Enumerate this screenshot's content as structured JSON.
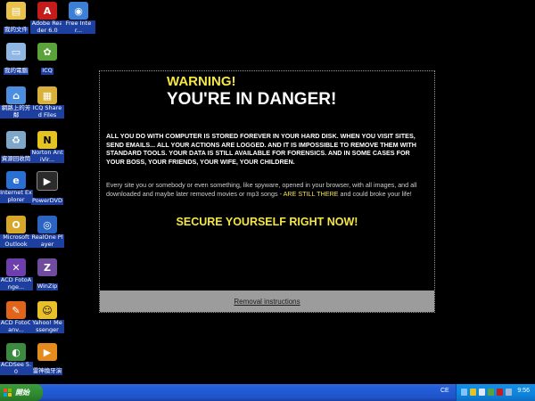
{
  "desktop": {
    "icons": [
      {
        "label": "我的文件",
        "name": "my-documents",
        "color": "#e8c24a",
        "glyph": "▤"
      },
      {
        "label": "Adobe Reader 6.0",
        "name": "adobe-reader",
        "color": "#c41b1b",
        "glyph": "A"
      },
      {
        "label": "Free Inter...",
        "name": "free-internet",
        "color": "#3c7fd6",
        "glyph": "◉"
      },
      {
        "label": "我的電腦",
        "name": "my-computer",
        "color": "#8fb7e6",
        "glyph": "▭"
      },
      {
        "label": "ICQ",
        "name": "icq",
        "color": "#5aa33a",
        "glyph": "✿"
      },
      {
        "label": "網路上的芳鄰",
        "name": "network-places",
        "color": "#4b8ee0",
        "glyph": "⌂"
      },
      {
        "label": "ICQ Shared Files",
        "name": "icq-shared-files",
        "color": "#d9b13a",
        "glyph": "▦"
      },
      {
        "label": "資源回收筒",
        "name": "recycle-bin",
        "color": "#7fa7c9",
        "glyph": "♻"
      },
      {
        "label": "Norton AntiVir...",
        "name": "norton-antivirus",
        "color": "#e5c320",
        "glyph": "N"
      },
      {
        "label": "Internet Explorer",
        "name": "internet-explorer",
        "color": "#2a6fd3",
        "glyph": "e"
      },
      {
        "label": "PowerDVD",
        "name": "powerdvd",
        "color": "#2b2b2b",
        "glyph": "▶"
      },
      {
        "label": "Microsoft Outlook",
        "name": "outlook",
        "color": "#d8a72a",
        "glyph": "O"
      },
      {
        "label": "RealOne Player",
        "name": "realone-player",
        "color": "#2c64c4",
        "glyph": "◎"
      },
      {
        "label": "ACD FotoAnge...",
        "name": "acd-fotoangelo",
        "color": "#6d3fae",
        "glyph": "✕"
      },
      {
        "label": "WinZip",
        "name": "winzip",
        "color": "#6f4d9c",
        "glyph": "Z"
      },
      {
        "label": "ACD FotoCanv...",
        "name": "acd-fotocanvas",
        "color": "#e0641c",
        "glyph": "✎"
      },
      {
        "label": "Yahoo! Messenger",
        "name": "yahoo-messenger",
        "color": "#e9c02a",
        "glyph": "☺"
      },
      {
        "label": "ACDSee 5.0",
        "name": "acdsee",
        "color": "#3a8a3f",
        "glyph": "◐"
      },
      {
        "label": "雷神換牙演",
        "name": "misc-app",
        "color": "#e58a1c",
        "glyph": "▶"
      }
    ]
  },
  "popup": {
    "warning_title": "WARNING!",
    "danger_title": "YOU'RE IN DANGER!",
    "bold_paragraph": "ALL YOU DO WITH COMPUTER IS STORED FOREVER IN YOUR HARD DISK. WHEN YOU VISIT SITES, SEND EMAILS... ALL YOUR ACTIONS ARE LOGGED. AND IT IS IMPOSSIBLE TO REMOVE THEM WITH STANDARD TOOLS. YOUR DATA IS STILL AVAILABLE FOR FORENSICS. AND IN SOME CASES FOR YOUR BOSS, YOUR FRIENDS, YOUR WIFE, YOUR CHILDREN.",
    "plain_paragraph_start": "Every site you or somebody or even something, like spyware, opened in your browser, with all images, and all downloaded and maybe later removed movies or mp3 songs - ",
    "plain_paragraph_highlight": "ARE STILL THERE",
    "plain_paragraph_end": " and could broke your life!",
    "secure_text": "SECURE YOURSELF RIGHT NOW!",
    "removal_link": "Removal instructions"
  },
  "taskbar": {
    "start_label": "開始",
    "language": "CE",
    "clock": "9:56"
  },
  "colors": {
    "warning_yellow": "#f5e642",
    "taskbar_blue": "#245edb",
    "start_green": "#2f8a2f"
  }
}
